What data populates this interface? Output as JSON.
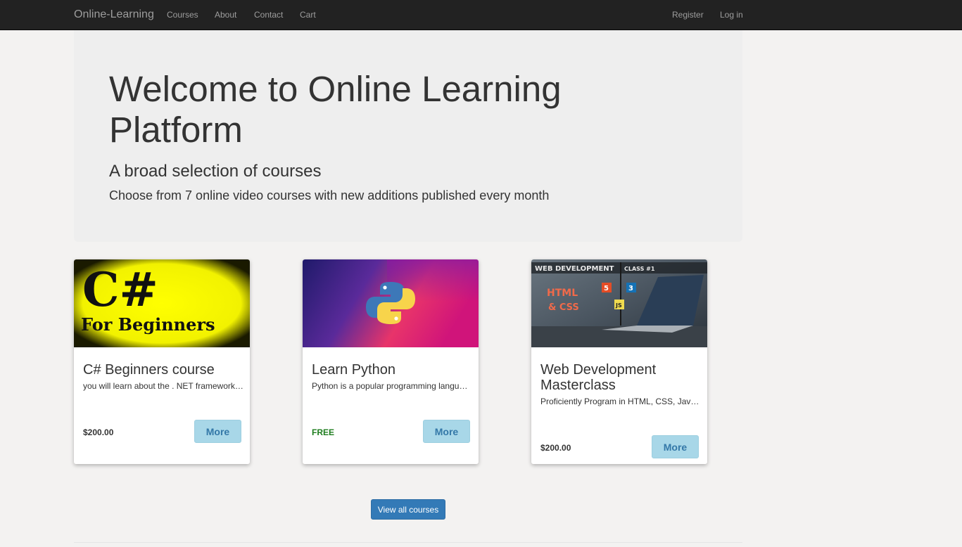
{
  "navbar": {
    "brand": "Online-Learning",
    "links": [
      "Courses",
      "About",
      "Contact",
      "Cart"
    ],
    "right_links": [
      "Register",
      "Log in"
    ]
  },
  "hero": {
    "title": "Welcome to Online Learning Platform",
    "subtitle": "A broad selection of courses",
    "text": "Choose from 7 online video courses with new additions published every month"
  },
  "courses": [
    {
      "title": "C# Beginners course",
      "description": "you will learn about the . NET framework, the C# language and how to build applications",
      "price": "$200.00",
      "button": "More",
      "image_text": [
        "C#",
        "For Beginners"
      ]
    },
    {
      "title": "Learn Python",
      "description": "Python is a popular programming language used for web development and data science",
      "price": "FREE",
      "button": "More"
    },
    {
      "title": "Web Development Masterclass",
      "description": "Proficiently Program in HTML, CSS, JavaScript and build responsive websites",
      "price": "$200.00",
      "button": "More",
      "image_text": [
        "WEB DEVELOPMENT",
        "CLASS #1",
        "HTML",
        "& CSS",
        "5",
        "3",
        "JS"
      ]
    }
  ],
  "view_all_button": "View all courses",
  "colors": {
    "navbar_bg": "#222222",
    "jumbotron_bg": "#eeeeee",
    "more_button_bg": "#a8d7e8",
    "primary_button_bg": "#337ab7",
    "free_price": "#1e7d1e"
  }
}
